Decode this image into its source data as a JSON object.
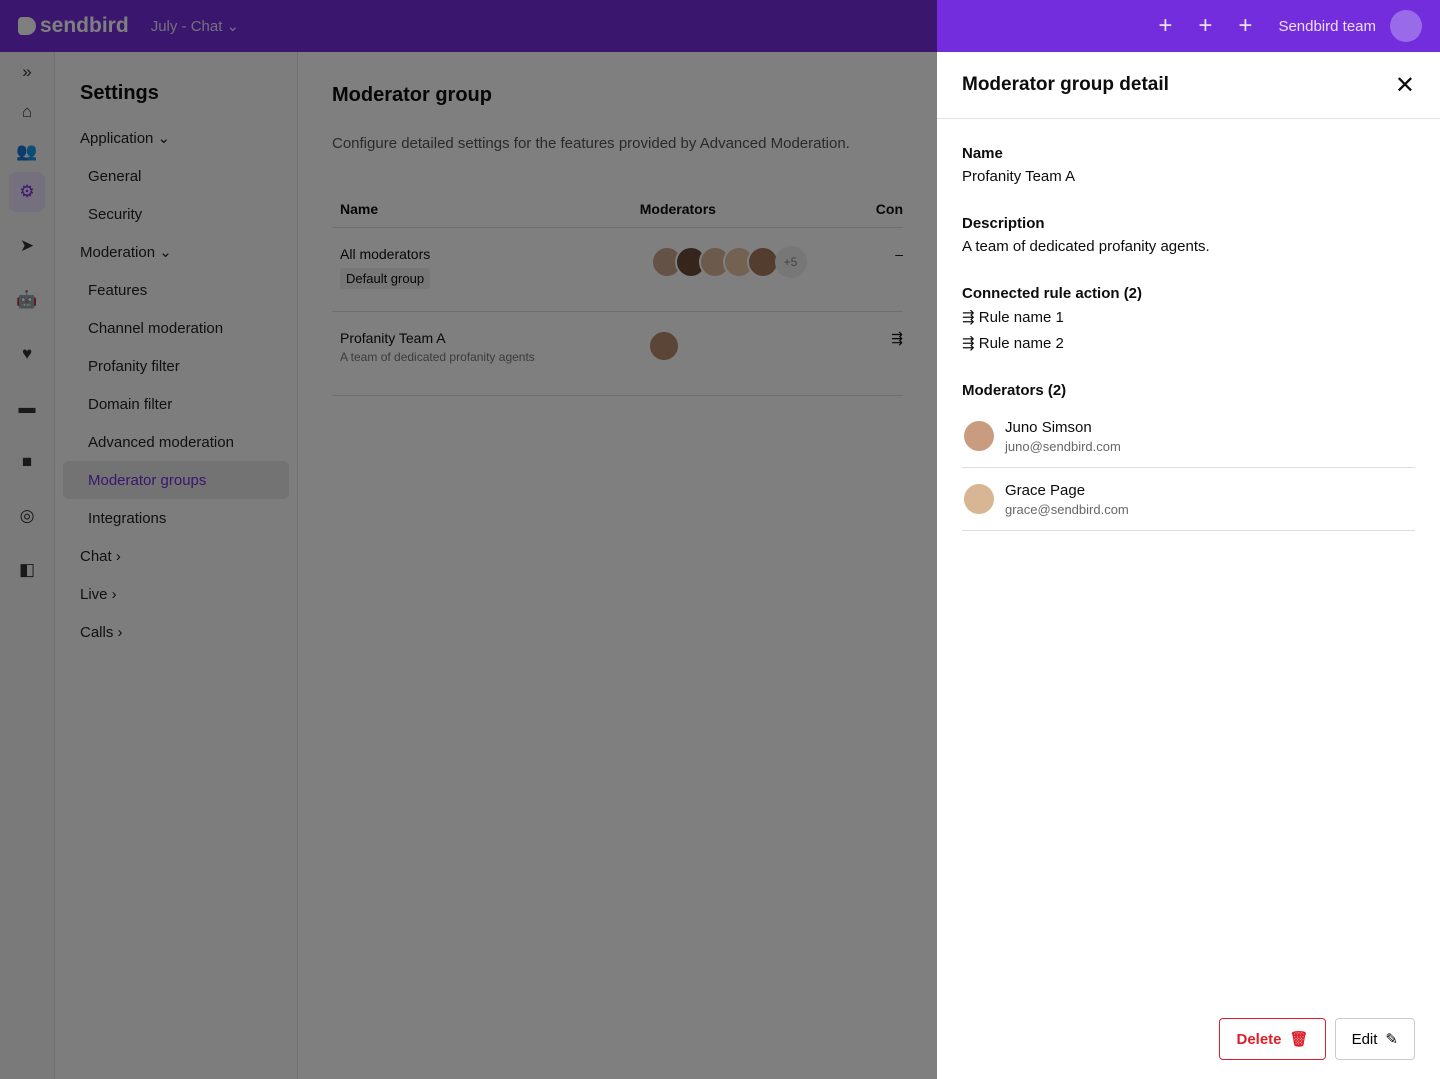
{
  "topbar": {
    "logo": "sendbird",
    "app": "July - Chat",
    "user": "Sendbird team"
  },
  "colors": {
    "brand": "#742ddd",
    "danger": "#de1e2a"
  },
  "rail": {
    "icons": [
      "expand-icon",
      "home-icon",
      "users-icon",
      "settings-icon",
      "send-icon",
      "bot-icon",
      "heart-icon",
      "chat-icon",
      "video-icon",
      "live-icon",
      "desk-icon"
    ]
  },
  "nav": {
    "title": "Settings",
    "items": [
      {
        "label": "Application ⌄",
        "group": true
      },
      {
        "label": "General"
      },
      {
        "label": "Security"
      },
      {
        "label": "Moderation ⌄",
        "group": true
      },
      {
        "label": "Features"
      },
      {
        "label": "Channel moderation"
      },
      {
        "label": "Profanity filter"
      },
      {
        "label": "Domain filter"
      },
      {
        "label": "Advanced moderation"
      },
      {
        "label": "Moderator groups",
        "selected": true
      },
      {
        "label": "Integrations"
      },
      {
        "label": "Chat ›",
        "group": true
      },
      {
        "label": "Live ›",
        "group": true
      },
      {
        "label": "Calls ›",
        "group": true
      }
    ]
  },
  "main": {
    "title": "Moderator group",
    "description": "Configure detailed settings for the features provided by Advanced Moderation.",
    "columns": [
      "Name",
      "Moderators",
      "Con"
    ],
    "rows": [
      {
        "name": "All moderators",
        "badge": "Default group",
        "more": "+5",
        "conn": "–"
      },
      {
        "name": "Profanity Team A",
        "sub": "A team of dedicated profanity agents",
        "more": "",
        "conn": "⇶"
      }
    ]
  },
  "panel": {
    "title": "Moderator group detail",
    "name_label": "Name",
    "name": "Profanity Team A",
    "desc_label": "Description",
    "desc": "A team of dedicated profanity agents.",
    "rules_label": "Connected rule action (2)",
    "rules": [
      "Rule name 1",
      "Rule name 2"
    ],
    "mods_label": "Moderators (2)",
    "mods": [
      {
        "name": "Juno Simson",
        "email": "juno@sendbird.com"
      },
      {
        "name": "Grace Page",
        "email": "grace@sendbird.com"
      }
    ],
    "delete": "Delete",
    "edit": "Edit"
  }
}
